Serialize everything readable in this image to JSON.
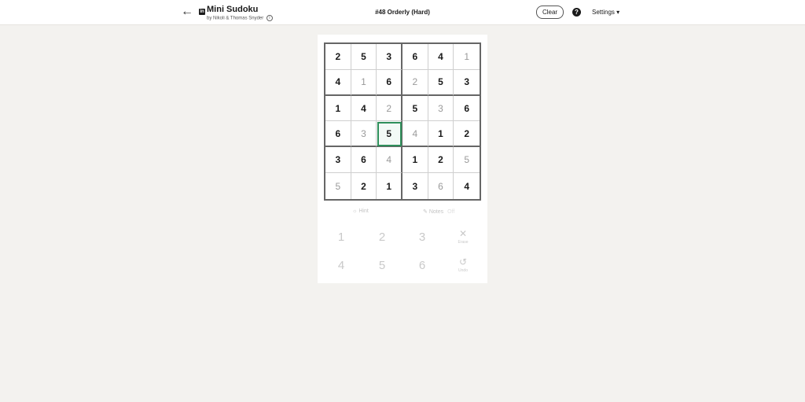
{
  "header": {
    "back_icon": "arrow-left-icon",
    "logo_text": "in",
    "app_title": "Mini Sudoku",
    "byline": "by Nikoli & Thomas Snyder",
    "byline_info_icon": "i",
    "puzzle_title": "#48 Orderly (Hard)",
    "clear_label": "Clear",
    "help_icon": "?",
    "settings_label": "Settings ▾"
  },
  "board": {
    "rows": [
      [
        {
          "v": "2",
          "given": true
        },
        {
          "v": "5",
          "given": true
        },
        {
          "v": "3",
          "given": true
        },
        {
          "v": "6",
          "given": true
        },
        {
          "v": "4",
          "given": true
        },
        {
          "v": "1",
          "given": false
        }
      ],
      [
        {
          "v": "4",
          "given": true
        },
        {
          "v": "1",
          "given": false
        },
        {
          "v": "6",
          "given": true
        },
        {
          "v": "2",
          "given": false
        },
        {
          "v": "5",
          "given": true
        },
        {
          "v": "3",
          "given": true
        }
      ],
      [
        {
          "v": "1",
          "given": true
        },
        {
          "v": "4",
          "given": true
        },
        {
          "v": "2",
          "given": false
        },
        {
          "v": "5",
          "given": true
        },
        {
          "v": "3",
          "given": false
        },
        {
          "v": "6",
          "given": true
        }
      ],
      [
        {
          "v": "6",
          "given": true
        },
        {
          "v": "3",
          "given": false
        },
        {
          "v": "5",
          "given": true,
          "selected": true
        },
        {
          "v": "4",
          "given": false
        },
        {
          "v": "1",
          "given": true
        },
        {
          "v": "2",
          "given": true
        }
      ],
      [
        {
          "v": "3",
          "given": true
        },
        {
          "v": "6",
          "given": true
        },
        {
          "v": "4",
          "given": false
        },
        {
          "v": "1",
          "given": true
        },
        {
          "v": "2",
          "given": true
        },
        {
          "v": "5",
          "given": false
        }
      ],
      [
        {
          "v": "5",
          "given": false
        },
        {
          "v": "2",
          "given": true
        },
        {
          "v": "1",
          "given": true
        },
        {
          "v": "3",
          "given": true
        },
        {
          "v": "6",
          "given": false
        },
        {
          "v": "4",
          "given": true
        }
      ]
    ]
  },
  "tools": {
    "hint_icon": "☼",
    "hint_label": "Hint",
    "notes_icon": "✎",
    "notes_label": "Notes",
    "notes_state": "Off"
  },
  "keypad": {
    "keys": [
      "1",
      "2",
      "3",
      "4",
      "5",
      "6"
    ],
    "erase_icon": "✕",
    "erase_label": "Erase",
    "undo_icon": "↺",
    "undo_label": "Undo"
  },
  "colors": {
    "background": "#f3f2ef",
    "selected_outline": "#2f8f5b",
    "given_digit": "#1a1a1a",
    "entered_digit": "#9a9a9a"
  }
}
